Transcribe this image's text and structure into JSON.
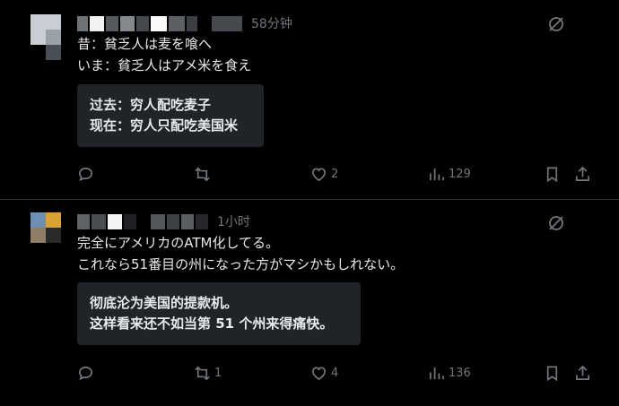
{
  "posts": [
    {
      "time": "58分钟",
      "text_line1": "昔：貧乏人は麦を喰へ",
      "text_line2": "いま：貧乏人はアメ米を食え",
      "translation_line1": "过去：穷人配吃麦子",
      "translation_line2": "现在：穷人只配吃美国米",
      "reply_count": "",
      "repost_count": "",
      "like_count": "2",
      "view_count": "129"
    },
    {
      "time": "1小时",
      "text_line1": "完全にアメリカのATM化してる。",
      "text_line2": "これなら51番目の州になった方がマシかもしれない。",
      "translation_line1": "彻底沦为美国的提款机。",
      "translation_line2": "这样看来还不如当第 51 个州来得痛快。",
      "reply_count": "",
      "repost_count": "1",
      "like_count": "4",
      "view_count": "136"
    }
  ],
  "colors": {
    "background": "#000000",
    "text": "#e7e9ea",
    "muted": "#71767b",
    "translation_box": "#202327",
    "divider": "#2f3336"
  },
  "icons": [
    "reply-icon",
    "repost-icon",
    "like-icon",
    "views-icon",
    "bookmark-icon",
    "share-icon",
    "grok-icon"
  ]
}
